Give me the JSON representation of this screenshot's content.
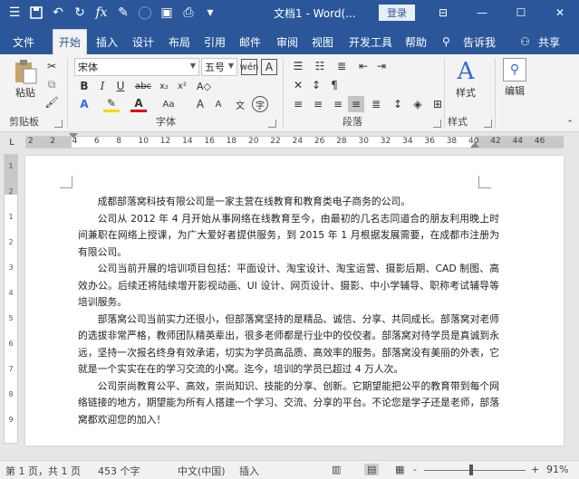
{
  "titlebar": {
    "title": "文档1 - Word(...",
    "login_label": "登录",
    "quick_access": [
      "save-icon",
      "undo-icon",
      "redo-icon",
      "formula-icon",
      "brush-icon",
      "circle-icon",
      "camera-icon",
      "print-icon",
      "more-icon"
    ]
  },
  "tabs": [
    {
      "label": "文件"
    },
    {
      "label": "开始"
    },
    {
      "label": "插入"
    },
    {
      "label": "设计"
    },
    {
      "label": "布局"
    },
    {
      "label": "引用"
    },
    {
      "label": "邮件"
    },
    {
      "label": "审阅"
    },
    {
      "label": "视图"
    },
    {
      "label": "开发工具"
    },
    {
      "label": "帮助"
    },
    {
      "label": "告诉我"
    },
    {
      "label": "共享"
    }
  ],
  "ribbon": {
    "paste_label": "粘贴",
    "font_name": "宋体",
    "font_size": "五号",
    "style_label": "样式",
    "edit_label": "编辑",
    "groups": {
      "clipboard": "剪贴板",
      "font": "字体",
      "paragraph": "段落",
      "styles": "样式"
    }
  },
  "ruler_ticks": [
    "2",
    "2",
    "4",
    "6",
    "8",
    "10",
    "12",
    "14",
    "16",
    "18",
    "20",
    "22",
    "24",
    "26",
    "28",
    "30",
    "32",
    "34",
    "36",
    "38",
    "40",
    "42",
    "44",
    "46"
  ],
  "vruler_ticks": [
    "1",
    "2",
    "1",
    "2",
    "3",
    "4",
    "5",
    "6",
    "7",
    "8",
    "9"
  ],
  "document": {
    "paragraphs": [
      "成都部落窝科技有限公司是一家主营在线教育和教育类电子商务的公司。",
      "公司从 2012 年 4 月开始从事网络在线教育至今，由最初的几名志同道合的朋友利用晚上时间兼职在网络上授课，为广大爱好者提供服务，到 2015 年 1 月根据发展需要，在成都市注册为有限公司。",
      "公司当前开展的培训项目包括：平面设计、淘宝设计、淘宝运营、摄影后期、CAD 制图、高效办公。后续还将陆续增开影视动画、UI 设计、网页设计、摄影、中小学辅导、职称考试辅导等培训服务。",
      "部落窝公司当前实力还很小，但部落窝坚持的是精品、诚信、分享、共同成长。部落窝对老师的选拔非常严格，教师团队精英辈出，很多老师都是行业中的佼佼者。部落窝对待学员是真诚到永远，坚持一次报名终身有效承诺，切实为学员高品质、高效率的服务。部落窝没有美丽的外表，它就是一个实实在在的学习交流的小窝。迄今，培训的学员已超过 4 万人次。",
      "公司崇尚教育公平、高效，崇尚知识、技能的分享、创新。它期望能把公平的教育带到每个网络链接的地方，期望能为所有人搭建一个学习、交流、分享的平台。不论您是学子还是老师，部落窝都欢迎您的加入！"
    ]
  },
  "status": {
    "pages": "第 1 页，共 1 页",
    "words": "453 个字",
    "language": "中文(中国)",
    "mode": "插入",
    "zoom_minus": "-",
    "zoom_plus": "+",
    "zoom": "91%",
    "zoom_fraction": 0.46
  }
}
